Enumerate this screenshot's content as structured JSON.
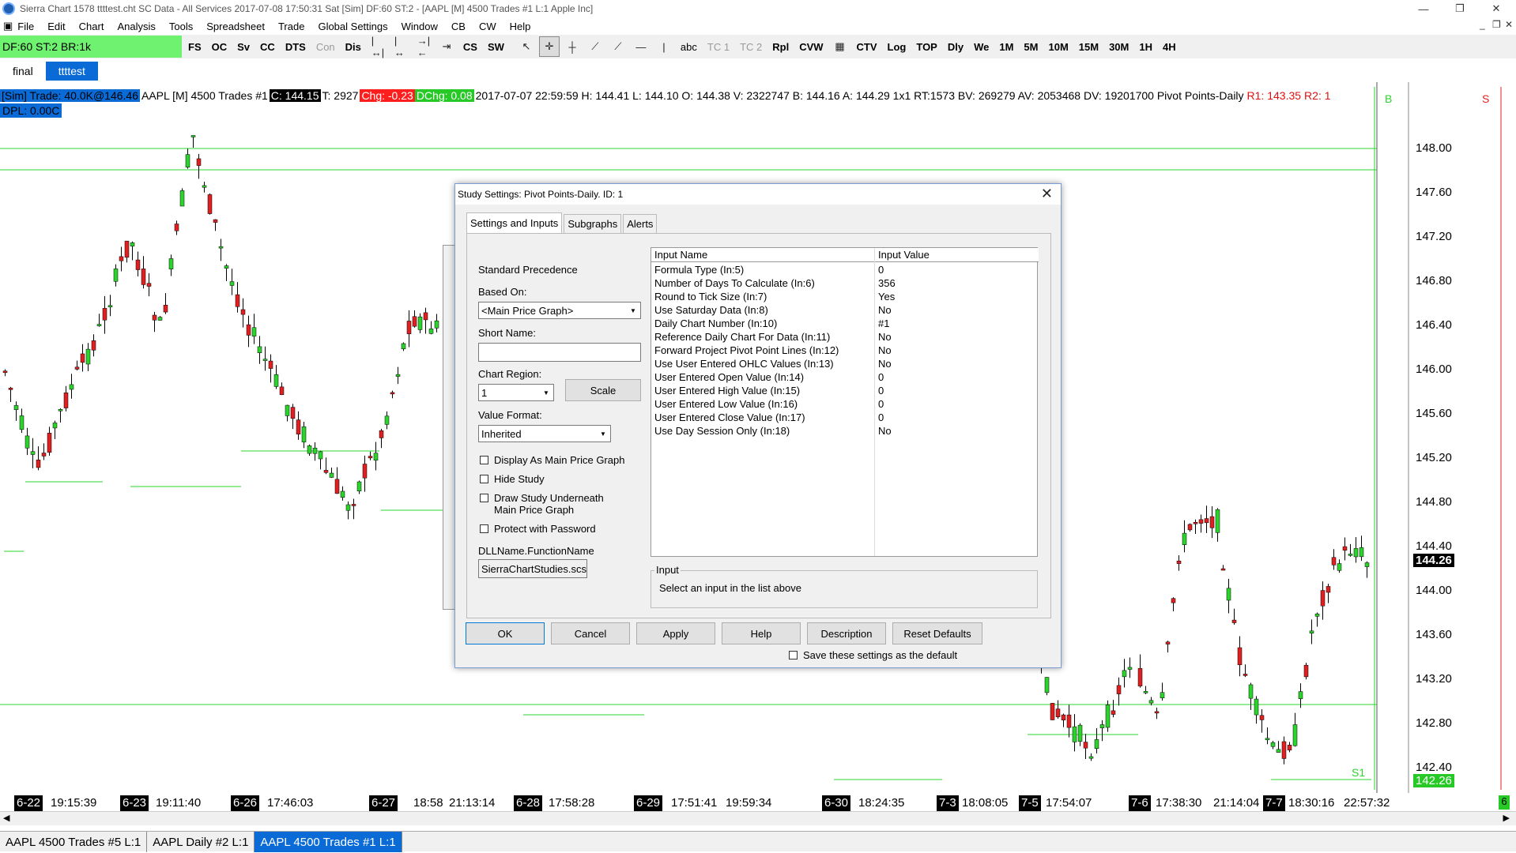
{
  "window": {
    "title": "Sierra Chart 1578 ttttest.cht  SC Data - All Services 2017-07-08  17:50:31 Sat [Sim]  DF:60  ST:2 - [AAPL [M]  4500 Trades  #1  L:1  Apple Inc]",
    "minimize": "—",
    "restore": "❐",
    "close": "✕"
  },
  "menu": [
    "File",
    "Edit",
    "Chart",
    "Analysis",
    "Tools",
    "Spreadsheet",
    "Trade",
    "Global Settings",
    "Window",
    "CB",
    "CW",
    "Help"
  ],
  "toolbar": {
    "status": "DF:60  ST:2  BR:1k",
    "buttons_a": [
      "FS",
      "OC",
      "Sv",
      "CC",
      "DTS",
      "Con",
      "Dis"
    ],
    "buttons_b": [
      "CS",
      "SW"
    ],
    "buttons_c": [
      "abc",
      "TC 1",
      "TC 2",
      "Rpl",
      "CVW"
    ],
    "buttons_d": [
      "CTV",
      "Log",
      "TOP",
      "Dly",
      "We",
      "1M",
      "5M",
      "10M",
      "15M",
      "30M",
      "1H",
      "4H"
    ]
  },
  "chart_tabs": [
    "final",
    "ttttest"
  ],
  "info": {
    "sim": "[Sim]  Trade: 40.0K@146.46",
    "symbol": "AAPL [M]  4500 Trades  #1",
    "close": "C: 144.15",
    "t": "T: 2927",
    "chg": "Chg: -0.23",
    "dchg": "DChg: 0.08",
    "ohlc": "2017-07-07 22:59:59  H: 144.41  L: 144.10  O: 144.38  V: 2322747  B: 144.16  A: 144.29  1x1  RT:1573  BV: 269279  AV: 2053468  DV: 19201700  Pivot Points-Daily",
    "r1": "R1: 143.35",
    "r2": "R2: 1",
    "dpl": "DPL: 0.00C",
    "b": "B",
    "s": "S"
  },
  "price_axis": [
    "148.00",
    "147.60",
    "147.20",
    "146.80",
    "146.40",
    "146.00",
    "145.60",
    "145.20",
    "144.80",
    "144.40",
    "144.00",
    "143.60",
    "143.20",
    "142.80",
    "142.40"
  ],
  "last_price": "144.26",
  "pivot_price": "142.26",
  "s1_label": "S1",
  "scroll_num": "6",
  "time_axis": [
    {
      "t": "6-22",
      "d": true
    },
    {
      "t": "19:15:39",
      "d": false
    },
    {
      "t": "6-23",
      "d": true
    },
    {
      "t": "19:11:40",
      "d": false
    },
    {
      "t": "6-26",
      "d": true
    },
    {
      "t": "17:46:03",
      "d": false
    },
    {
      "t": "6-27",
      "d": true
    },
    {
      "t": "18:58",
      "d": false
    },
    {
      "t": "21:13:14",
      "d": false
    },
    {
      "t": "6-28",
      "d": true
    },
    {
      "t": "17:58:28",
      "d": false
    },
    {
      "t": "6-29",
      "d": true
    },
    {
      "t": "17:51:41",
      "d": false
    },
    {
      "t": "19:59:34",
      "d": false
    },
    {
      "t": "6-30",
      "d": true
    },
    {
      "t": "18:24:35",
      "d": false
    },
    {
      "t": "7-3",
      "d": true
    },
    {
      "t": "18:08:05",
      "d": false
    },
    {
      "t": "7-5",
      "d": true
    },
    {
      "t": "17:54:07",
      "d": false
    },
    {
      "t": "7-6",
      "d": true
    },
    {
      "t": "17:38:30",
      "d": false
    },
    {
      "t": "21:14:04",
      "d": false
    },
    {
      "t": "7-7",
      "d": true
    },
    {
      "t": "18:30:16",
      "d": false
    },
    {
      "t": "22:57:32",
      "d": false
    }
  ],
  "bottom_tabs": [
    "AAPL   4500 Trades  #5   L:1",
    "AAPL   Daily  #2   L:1",
    "AAPL   4500 Trades  #1   L:1"
  ],
  "dialog": {
    "title": "Study Settings: Pivot Points-Daily. ID: 1",
    "tabs": [
      "Settings and Inputs",
      "Subgraphs",
      "Alerts"
    ],
    "standard_precedence": "Standard Precedence",
    "based_on_label": "Based On:",
    "based_on_value": "<Main Price Graph>",
    "short_name_label": "Short Name:",
    "short_name_value": "",
    "chart_region_label": "Chart Region:",
    "chart_region_value": "1",
    "scale_button": "Scale",
    "value_format_label": "Value Format:",
    "value_format_value": "Inherited",
    "checkboxes": [
      "Display As Main Price Graph",
      "Hide Study",
      "Draw Study Underneath",
      "Main Price Graph",
      "Protect with Password"
    ],
    "dll_label": "DLLName.FunctionName",
    "dll_value": "SierraChartStudies.scs",
    "grid_headers": [
      "Input Name",
      "Input Value"
    ],
    "inputs": [
      {
        "name": "Formula Type   (In:5)",
        "value": "0"
      },
      {
        "name": "Number of Days To Calculate   (In:6)",
        "value": "356"
      },
      {
        "name": "Round to Tick Size   (In:7)",
        "value": "Yes"
      },
      {
        "name": "Use Saturday Data   (In:8)",
        "value": "No"
      },
      {
        "name": "Daily Chart Number   (In:10)",
        "value": "#1"
      },
      {
        "name": "Reference Daily Chart For Data   (In:11)",
        "value": "No"
      },
      {
        "name": "Forward Project Pivot Point Lines   (In:12)",
        "value": "No"
      },
      {
        "name": "Use User Entered OHLC Values   (In:13)",
        "value": "No"
      },
      {
        "name": "User Entered Open Value   (In:14)",
        "value": "0"
      },
      {
        "name": "User Entered High Value   (In:15)",
        "value": "0"
      },
      {
        "name": "User Entered Low Value   (In:16)",
        "value": "0"
      },
      {
        "name": "User Entered Close Value   (In:17)",
        "value": "0"
      },
      {
        "name": "Use Day Session Only   (In:18)",
        "value": "No"
      }
    ],
    "input_group_label": "Input",
    "input_help": "Select an input in the list above",
    "buttons": [
      "OK",
      "Cancel",
      "Apply",
      "Help",
      "Description",
      "Reset Defaults"
    ],
    "save_default": "Save these settings as the default"
  }
}
